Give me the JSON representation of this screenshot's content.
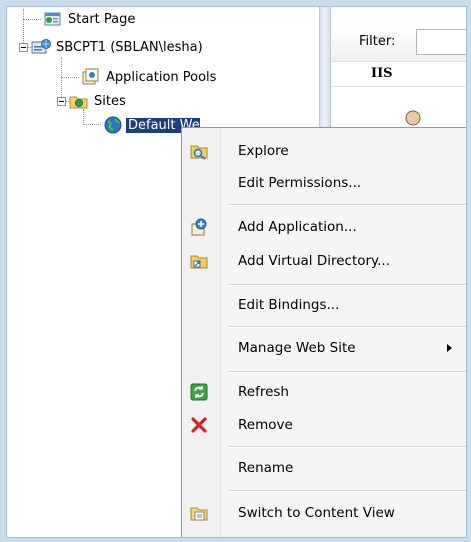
{
  "tree": {
    "nodes": [
      {
        "label": "Start Page",
        "icon": "start-page-icon"
      },
      {
        "label": "SBCPT1 (SBLAN\\lesha)",
        "icon": "server-icon"
      },
      {
        "label": "Application Pools",
        "icon": "application-pools-icon"
      },
      {
        "label": "Sites",
        "icon": "sites-folder-icon"
      },
      {
        "label": "Default Web Site",
        "icon": "globe-icon",
        "visible_text": "Defau"
      }
    ]
  },
  "right_pane": {
    "filter_label": "Filter:",
    "section_header": "IIS"
  },
  "context_menu": {
    "items": [
      {
        "label": "Explore",
        "icon": "explore-icon"
      },
      {
        "label": "Edit Permissions...",
        "icon": ""
      },
      {
        "label": "Add Application...",
        "icon": "add-application-icon"
      },
      {
        "label": "Add Virtual Directory...",
        "icon": "add-virtual-directory-icon"
      },
      {
        "label": "Edit Bindings...",
        "icon": ""
      },
      {
        "label": "Manage Web Site",
        "icon": "",
        "submenu": true
      },
      {
        "label": "Refresh",
        "icon": "refresh-icon"
      },
      {
        "label": "Remove",
        "icon": "remove-icon"
      },
      {
        "label": "Rename",
        "icon": ""
      },
      {
        "label": "Switch to Content View",
        "icon": "content-view-icon"
      }
    ]
  },
  "colors": {
    "selection": "#1c3f80",
    "menu_background": "#f5f5f5",
    "window_border": "#c9dced"
  }
}
